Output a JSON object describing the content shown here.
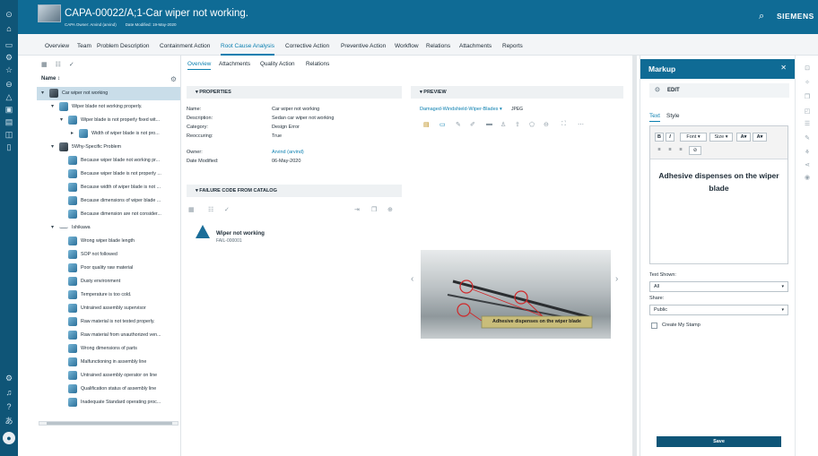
{
  "header": {
    "title": "CAPA-00022/A;1-Car wiper not working.",
    "owner": "CAPA Owner: Arvind (arvind)",
    "modified": "Date Modified: 19-May-2020",
    "brand": "SIEMENS"
  },
  "tabs": [
    "Overview",
    "Team",
    "Problem Description",
    "Containment Action",
    "Root Cause Analysis",
    "Corrective Action",
    "Preventive Action",
    "Workflow",
    "Relations",
    "Attachments",
    "Reports"
  ],
  "active_tab": "Root Cause Analysis",
  "tree": {
    "header": "Name ↕",
    "rows": [
      {
        "label": "Car wiper not working",
        "selected": true
      },
      {
        "label": "Wiper blade not working properly."
      },
      {
        "label": "Wiper blade is not properly fixed wit..."
      },
      {
        "label": "Width of wiper blade is not pro..."
      },
      {
        "label": "5Why-Specific Problem"
      },
      {
        "label": "Because wiper blade not working pr..."
      },
      {
        "label": "Because wiper blade is not properly ..."
      },
      {
        "label": "Because width of wiper blade is not ..."
      },
      {
        "label": "Because dimensions of wiper blade ..."
      },
      {
        "label": "Because dimension are not consider..."
      },
      {
        "label": "Ishikawa"
      },
      {
        "label": "Wrong wiper blade length"
      },
      {
        "label": "SOP not followed"
      },
      {
        "label": "Poor quality raw material"
      },
      {
        "label": "Dusty environment"
      },
      {
        "label": "Temperature is too cold."
      },
      {
        "label": "Untrained assembly supervisor"
      },
      {
        "label": "Raw material is not tested properly."
      },
      {
        "label": "Raw material from unauthorized ven..."
      },
      {
        "label": "Wrong dimensions of parts"
      },
      {
        "label": "Malfunctioning in assembly line"
      },
      {
        "label": "Untrained assembly operator on line"
      },
      {
        "label": "Qualification status of assembly line"
      },
      {
        "label": "Inadequate Standard operating proc..."
      }
    ]
  },
  "subtabs": [
    "Overview",
    "Attachments",
    "Quality Action",
    "Relations"
  ],
  "properties": {
    "title": "PROPERTIES",
    "items": [
      {
        "label": "Name:",
        "value": "Car wiper not working"
      },
      {
        "label": "Description:",
        "value": "Sedan car wiper not working"
      },
      {
        "label": "Category:",
        "value": "Design Error"
      },
      {
        "label": "Reoccuring:",
        "value": "True"
      },
      {
        "label": "Owner:",
        "value": "Arvind (arvind)"
      },
      {
        "label": "Date Modified:",
        "value": "06-May-2020"
      }
    ]
  },
  "failure": {
    "title": "FAILURE CODE FROM CATALOG",
    "name": "Wiper not working",
    "code": "FAIL-000001"
  },
  "preview": {
    "title": "PREVIEW",
    "file": "Damaged-Windshield-Wiper-Blades",
    "format": "JPEG",
    "annotation": "Adhesive dispenses on the wiper blade"
  },
  "markup": {
    "title": "Markup",
    "edit": "EDIT",
    "tabs": [
      "Text",
      "Style"
    ],
    "toolbar": {
      "bold": "B",
      "italic": "I",
      "font": "Font",
      "size": "Size",
      "color_a": "A",
      "bg_a": "A"
    },
    "text": "Adhesive dispenses on the wiper blade",
    "text_shown_label": "Text Shown:",
    "text_shown_value": "All",
    "share_label": "Share:",
    "share_value": "Public",
    "stamp_label": "Create My Stamp",
    "save": "Save"
  },
  "colors": {
    "header": "#0f6b95",
    "rail": "#0f5577",
    "accent": "#0a7fb0",
    "selected_row": "#c9dde9"
  }
}
